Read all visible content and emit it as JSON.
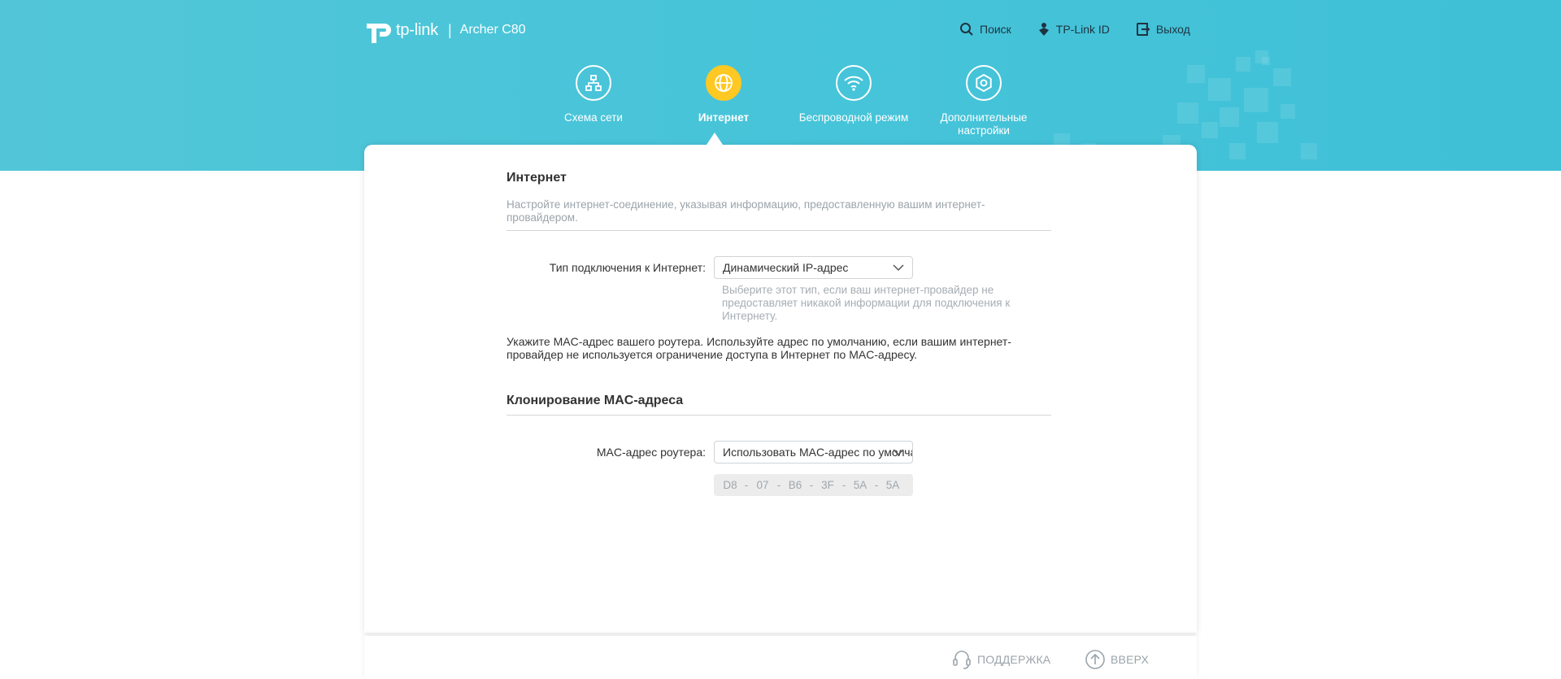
{
  "header": {
    "brand": "tp-link",
    "model": "Archer C80",
    "links": [
      {
        "label": "Поиск",
        "icon": "search-icon"
      },
      {
        "label": "TP-Link ID",
        "icon": "tplink-id-icon"
      },
      {
        "label": "Выход",
        "icon": "logout-icon"
      }
    ]
  },
  "nav": {
    "items": [
      {
        "label": "Схема сети",
        "icon": "network-map-icon",
        "active": false
      },
      {
        "label": "Интернет",
        "icon": "globe-icon",
        "active": true
      },
      {
        "label": "Беспроводной режим",
        "icon": "wifi-icon",
        "active": false
      },
      {
        "label": "Дополнительные настройки",
        "icon": "gear-icon",
        "active": false
      }
    ]
  },
  "internet": {
    "title": "Интернет",
    "description": "Настройте интернет-соединение, указывая информацию, предоставленную вашим интернет-провайдером.",
    "conn_type_label": "Тип подключения к Интернет:",
    "conn_type_value": "Динамический IP-адрес",
    "conn_type_hint": "Выберите этот тип, если ваш интернет-провайдер не предоставляет никакой информации для подключения к Интернету.",
    "mac_note": "Укажите MAC-адрес вашего роутера. Используйте адрес по умолчанию, если вашим интернет-провайдер не используется ограничение доступа в Интернет по MAC-адресу."
  },
  "mac_clone": {
    "title": "Клонирование MAC-адреса",
    "router_mac_label": "MAC-адрес роутера:",
    "router_mac_value": "Использовать MAC-адрес по умолчанию",
    "mac_octets": [
      "D8",
      "07",
      "B6",
      "3F",
      "5A",
      "5A"
    ],
    "separator": "-"
  },
  "footer": {
    "support": "ПОДДЕРЖКА",
    "top": "ВВЕРХ"
  },
  "colors": {
    "header_bg": "#47c4d9",
    "active_nav": "#ffc823",
    "text": "#333333",
    "muted": "#9ba4ab"
  }
}
